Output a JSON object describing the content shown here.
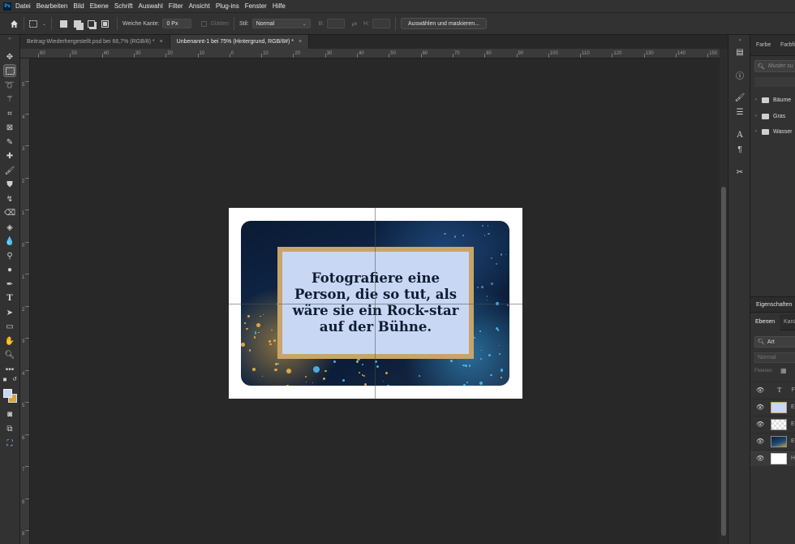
{
  "menu": [
    "Datei",
    "Bearbeiten",
    "Bild",
    "Ebene",
    "Schrift",
    "Auswahl",
    "Filter",
    "Ansicht",
    "Plug-ins",
    "Fenster",
    "Hilfe"
  ],
  "options": {
    "feather_label": "Weiche Kante:",
    "feather_value": "0 Px",
    "antialias_label": "Glätten",
    "style_label": "Stil:",
    "style_value": "Normal",
    "width_label": "B:",
    "height_label": "H:",
    "select_mask_button": "Auswählen und maskieren..."
  },
  "tabs": [
    {
      "label": "Beitrag-Wiederhergestellt.psd bei 66,7% (RGB/8) *",
      "close": "×"
    },
    {
      "label": "Unbenannt-1 bei 75% (Hintergrund, RGB/8#) *",
      "close": "×"
    }
  ],
  "ruler_h": [
    "60",
    "50",
    "40",
    "30",
    "20",
    "10",
    "0",
    "10",
    "20",
    "30",
    "40",
    "50",
    "60",
    "70",
    "80",
    "90",
    "100",
    "110",
    "120",
    "130",
    "140",
    "150"
  ],
  "ruler_v": [
    "5",
    "4",
    "3",
    "2",
    "1",
    "0",
    "1",
    "2",
    "3",
    "4",
    "5",
    "6",
    "7",
    "8",
    "9"
  ],
  "card": {
    "text": "Fotografiere eine Person, die so tut, als wäre sie ein Rock-star auf der Bühne."
  },
  "panel": {
    "tab_color": "Farbe",
    "tab_swatches": "Farbfi",
    "search_placeholder": "Muster su",
    "folders": [
      "Bäume",
      "Gras",
      "Wasser"
    ],
    "properties_label": "Eigenschaften",
    "layers_tab": "Ebenen",
    "channels_tab": "Kanä",
    "kind_filter": "Art",
    "blend_mode": "Normal",
    "fill_label": "Fixieren:",
    "layers": [
      {
        "type": "text",
        "icon": "T",
        "name": "F"
      },
      {
        "type": "image",
        "icon": "",
        "name": "E"
      },
      {
        "type": "transparent",
        "icon": "",
        "name": "E"
      },
      {
        "type": "photo",
        "icon": "",
        "name": "E"
      },
      {
        "type": "background",
        "icon": "",
        "name": "H"
      }
    ]
  },
  "colors": {
    "foreground": "#c8d7f3",
    "background": "#d4a64a",
    "frame": "#c9a46a",
    "textbox": "#c8d7f3"
  }
}
